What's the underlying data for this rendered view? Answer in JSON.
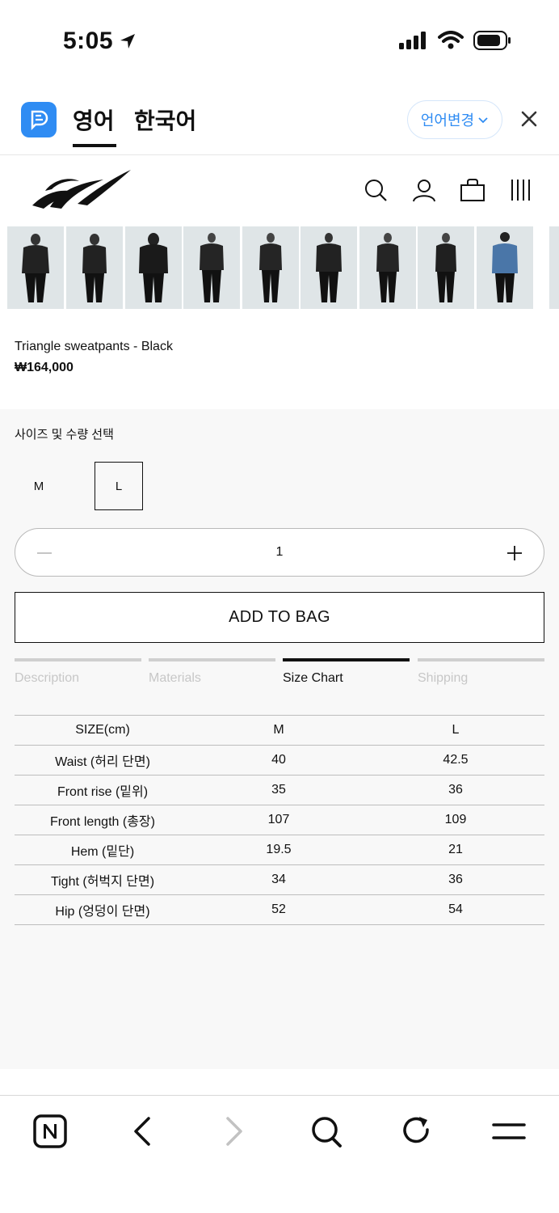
{
  "status_bar": {
    "time": "5:05"
  },
  "translate_bar": {
    "tab_english": "영어",
    "tab_korean": "한국어",
    "change_language": "언어변경"
  },
  "product": {
    "name": "Triangle sweatpants - Black",
    "price": "₩164,000"
  },
  "options": {
    "label": "사이즈 및 수량 선택",
    "sizes": [
      "M",
      "L"
    ],
    "selected_size": "L",
    "quantity": "1",
    "add_to_bag": "ADD TO BAG"
  },
  "tabs": [
    {
      "label": "Description",
      "active": false
    },
    {
      "label": "Materials",
      "active": false
    },
    {
      "label": "Size Chart",
      "active": true
    },
    {
      "label": "Shipping",
      "active": false
    }
  ],
  "size_chart": {
    "header": [
      "SIZE(cm)",
      "M",
      "L"
    ],
    "rows": [
      [
        "Waist (허리 단면)",
        "40",
        "42.5"
      ],
      [
        "Front rise (밑위)",
        "35",
        "36"
      ],
      [
        "Front length (총장)",
        "107",
        "109"
      ],
      [
        "Hem (밑단)",
        "19.5",
        "21"
      ],
      [
        "Tight (허벅지 단면)",
        "34",
        "36"
      ],
      [
        "Hip (엉덩이 단면)",
        "52",
        "54"
      ]
    ]
  },
  "icons": {
    "header": [
      "search-icon",
      "account-icon",
      "bag-icon",
      "menu-icon"
    ],
    "browser": [
      "naver-home-icon",
      "back-icon",
      "forward-icon",
      "search-icon",
      "refresh-icon",
      "menu-icon"
    ]
  },
  "colors": {
    "accent": "#2f8cf3",
    "text": "#111111",
    "muted": "#c7c7c7",
    "panel": "#f8f8f8"
  }
}
